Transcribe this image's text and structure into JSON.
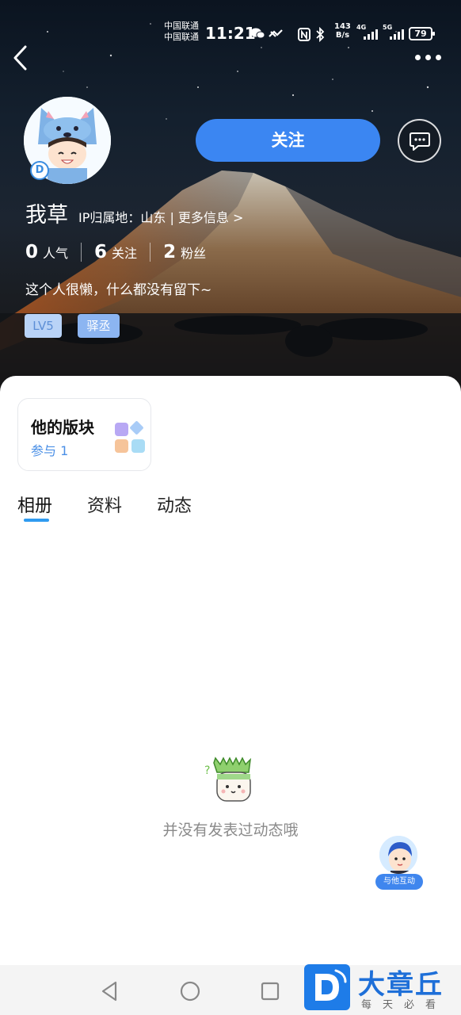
{
  "status_bar": {
    "carrier_1": "中国联通",
    "carrier_2": "中国联通",
    "time": "11:21",
    "net_speed_value": "143",
    "net_speed_unit": "B/s",
    "sim1_label": "4G",
    "sim2_label": "5G",
    "battery": "79"
  },
  "profile": {
    "username": "我草",
    "ip_info": "IP归属地：山东 | 更多信息 >",
    "follow_label": "关注",
    "stats": [
      {
        "num": "0",
        "label": "人气"
      },
      {
        "num": "6",
        "label": "关注"
      },
      {
        "num": "2",
        "label": "粉丝"
      }
    ],
    "bio": "这个人很懒，什么都没有留下~",
    "tags": [
      "LV5",
      "驿丞"
    ]
  },
  "board": {
    "title": "他的版块",
    "sub": "参与 1"
  },
  "tabs": [
    "相册",
    "资料",
    "动态"
  ],
  "active_tab": 0,
  "empty_text": "并没有发表过动态哦",
  "interact_label": "与他互动",
  "watermark": {
    "name": "大章丘",
    "slogan": "每天必看"
  },
  "colors": {
    "accent": "#3b86f2",
    "tab_indicator": "#2f9bf0"
  }
}
